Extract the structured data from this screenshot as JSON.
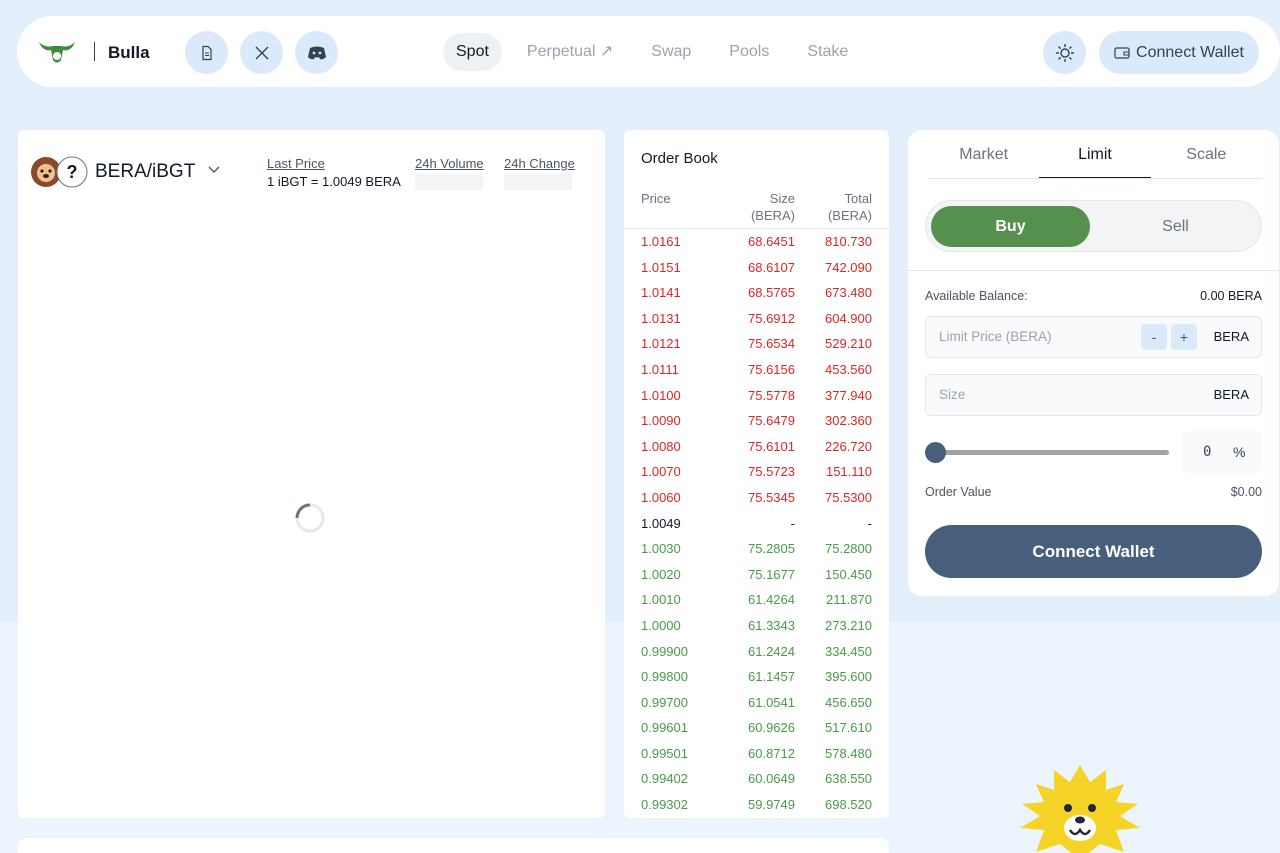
{
  "header": {
    "brand": "Bulla",
    "logo_icon": "bull-logo-icon",
    "social_icons": [
      "docs-icon",
      "x-icon",
      "discord-icon"
    ],
    "nav": [
      {
        "label": "Spot",
        "active": true
      },
      {
        "label": "Perpetual ↗",
        "active": false
      },
      {
        "label": "Swap",
        "active": false
      },
      {
        "label": "Pools",
        "active": false
      },
      {
        "label": "Stake",
        "active": false
      }
    ],
    "theme_icon": "sun-icon",
    "connect_wallet": "Connect Wallet"
  },
  "market": {
    "pair": "BERA/iBGT",
    "base_icon": "bear-token-icon",
    "quote_icon": "unknown-token-icon",
    "unknown_glyph": "?",
    "last_price_label": "Last Price",
    "last_price_value": "1 iBGT = 1.0049 BERA",
    "volume_label": "24h Volume",
    "change_label": "24h Change"
  },
  "order_book": {
    "title": "Order Book",
    "col_price": "Price",
    "col_size": "Size",
    "col_size_unit": "(BERA)",
    "col_total": "Total",
    "col_total_unit": "(BERA)",
    "asks": [
      [
        "1.0161",
        "68.6451",
        "810.730"
      ],
      [
        "1.0151",
        "68.6107",
        "742.090"
      ],
      [
        "1.0141",
        "68.5765",
        "673.480"
      ],
      [
        "1.0131",
        "75.6912",
        "604.900"
      ],
      [
        "1.0121",
        "75.6534",
        "529.210"
      ],
      [
        "1.0111",
        "75.6156",
        "453.560"
      ],
      [
        "1.0100",
        "75.5778",
        "377.940"
      ],
      [
        "1.0090",
        "75.6479",
        "302.360"
      ],
      [
        "1.0080",
        "75.6101",
        "226.720"
      ],
      [
        "1.0070",
        "75.5723",
        "151.110"
      ],
      [
        "1.0060",
        "75.5345",
        "75.5300"
      ]
    ],
    "mid": [
      "1.0049",
      "-",
      "-"
    ],
    "bids": [
      [
        "1.0030",
        "75.2805",
        "75.2800"
      ],
      [
        "1.0020",
        "75.1677",
        "150.450"
      ],
      [
        "1.0010",
        "61.4264",
        "211.870"
      ],
      [
        "1.0000",
        "61.3343",
        "273.210"
      ],
      [
        "0.99900",
        "61.2424",
        "334.450"
      ],
      [
        "0.99800",
        "61.1457",
        "395.600"
      ],
      [
        "0.99700",
        "61.0541",
        "456.650"
      ],
      [
        "0.99601",
        "60.9626",
        "517.610"
      ],
      [
        "0.99501",
        "60.8712",
        "578.480"
      ],
      [
        "0.99402",
        "60.0649",
        "638.550"
      ],
      [
        "0.99302",
        "59.9749",
        "698.520"
      ]
    ]
  },
  "trade": {
    "tabs": [
      {
        "label": "Market",
        "active": false
      },
      {
        "label": "Limit",
        "active": true
      },
      {
        "label": "Scale",
        "active": false
      }
    ],
    "buy": "Buy",
    "sell": "Sell",
    "balance_label": "Available Balance:",
    "balance_value": "0.00 BERA",
    "limit_price_placeholder": "Limit Price (BERA)",
    "minus": "-",
    "plus": "+",
    "limit_unit": "BERA",
    "size_placeholder": "Size",
    "size_unit": "BERA",
    "percent_value": "0",
    "percent_symbol": "%",
    "slider_fraction": 0,
    "order_value_label": "Order Value",
    "order_value": "$0.00",
    "connect_wallet": "Connect Wallet"
  },
  "colors": {
    "ask": "#dc2626",
    "bid": "#4a9a4a",
    "buy": "#55904f",
    "primary": "#475f7b",
    "page_bg": "#e3f0fc"
  }
}
